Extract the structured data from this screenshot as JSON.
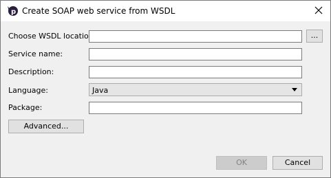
{
  "window": {
    "title": "Create SOAP web service from WSDL"
  },
  "form": {
    "wsdl_label": "Choose WSDL location:",
    "wsdl_value": "",
    "browse_label": "...",
    "service_label": "Service name:",
    "service_value": "",
    "description_label": "Description:",
    "description_value": "",
    "language_label": "Language:",
    "language_value": "Java",
    "package_label": "Package:",
    "package_value": ""
  },
  "buttons": {
    "advanced": "Advanced...",
    "ok": "OK",
    "cancel": "Cancel"
  },
  "colors": {
    "logo": "#2b1f3d"
  }
}
